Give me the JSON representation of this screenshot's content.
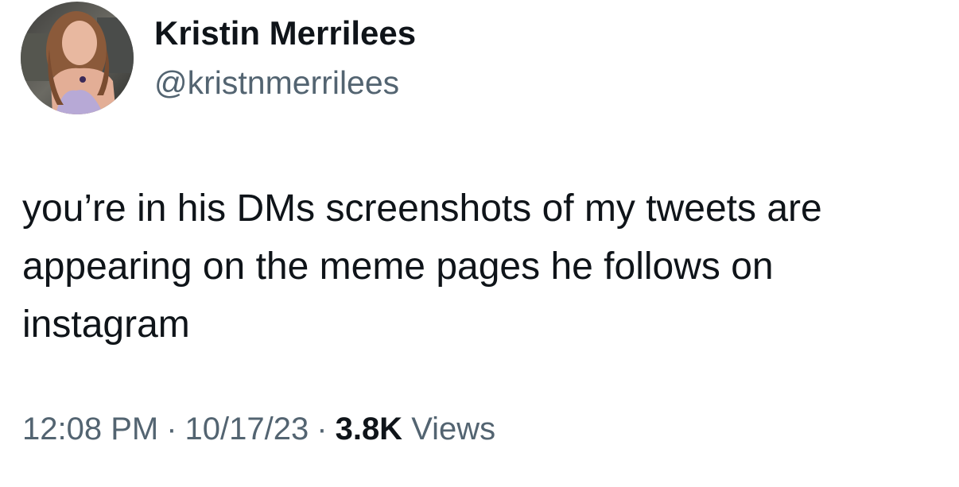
{
  "author": {
    "display_name": "Kristin Merrilees",
    "handle": "@kristnmerrilees"
  },
  "tweet": {
    "text": "you’re in his DMs screenshots of my tweets are appearing on the meme pages he follows on instagram",
    "time": "12:08 PM",
    "date": "10/17/23",
    "separator": "·",
    "views_count": "3.8K",
    "views_label": "Views"
  },
  "colors": {
    "text_primary": "#0f1419",
    "text_secondary": "#536471",
    "background": "#ffffff"
  }
}
